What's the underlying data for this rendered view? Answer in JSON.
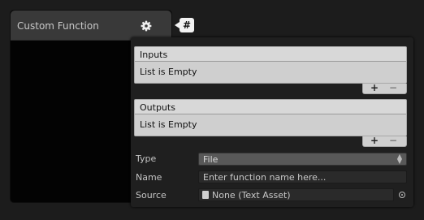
{
  "node": {
    "title": "Custom Function",
    "hash_label": "#"
  },
  "inputs": {
    "header": "Inputs",
    "empty_text": "List is Empty",
    "add": "+",
    "remove": "−"
  },
  "outputs": {
    "header": "Outputs",
    "empty_text": "List is Empty",
    "add": "+",
    "remove": "−"
  },
  "properties": {
    "type_label": "Type",
    "type_value": "File",
    "name_label": "Name",
    "name_placeholder": "Enter function name here...",
    "source_label": "Source",
    "source_value": "None (Text Asset)"
  },
  "icons": {
    "settings": "gear-icon",
    "hash": "hash-icon",
    "file": "text-asset-icon",
    "picker": "object-picker-icon"
  }
}
